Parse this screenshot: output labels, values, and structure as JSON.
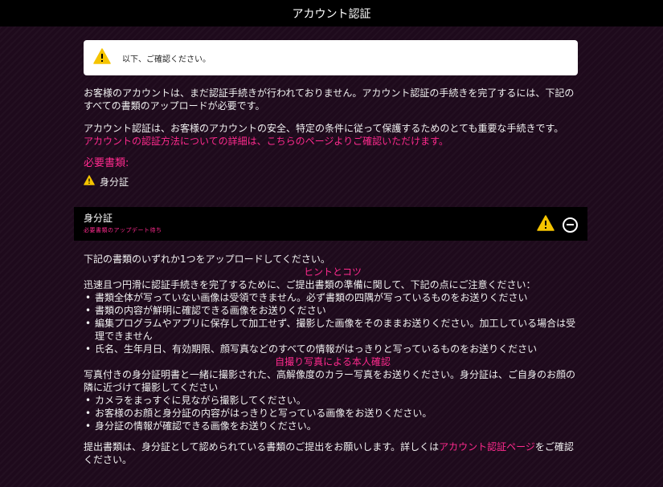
{
  "header": {
    "title": "アカウント認証"
  },
  "notice": {
    "text": "以下、ご確認ください。",
    "icon": "warning-icon"
  },
  "intro": {
    "p1": "お客様のアカウントは、まだ認証手続きが行われておりません。アカウント認証の手続きを完了するには、下記のすべての書類のアップロードが必要です。",
    "p2": "アカウント認証は、お客様のアカウントの安全、特定の条件に従って保護するためのとても重要な手続きです。",
    "link": "アカウントの認証方法についての詳細は、こちらのページよりご確認いただけます。"
  },
  "required_docs": {
    "title": "必要書類:",
    "items": [
      {
        "label": "身分証",
        "icon": "warning-icon"
      }
    ]
  },
  "panel": {
    "title": "身分証",
    "status": "必要書類のアップデート待ち"
  },
  "details": {
    "lead": "下記の書類のいずれか1つをアップロードしてください。",
    "tips_title": "ヒントとコツ",
    "tips_intro": "迅速且つ円滑に認証手続きを完了するために、ご提出書類の準備に関して、下記の点にご注意ください：",
    "tips": [
      "書類全体が写っていない画像は受領できません。必ず書類の四隅が写っているものをお送りください",
      "書類の内容が鮮明に確認できる画像をお送りください",
      "編集プログラムやアプリに保存して加工せず、撮影した画像をそのままお送りください。加工している場合は受理できません",
      "氏名、生年月日、有効期限、顔写真などのすべての情報がはっきりと写っているものをお送りください"
    ],
    "selfie_title": "自撮り写真による本人確認",
    "selfie_intro": "写真付きの身分証明書と一緒に撮影された、高解像度のカラー写真をお送りください。身分証は、ご自身のお顔の隣に近づけて撮影してください",
    "selfie_points": [
      "カメラをまっすぐに見ながら撮影してください。",
      "お客様のお顔と身分証の内容がはっきりと写っている画像をお送りください。",
      "身分証の情報が確認できる画像をお送りください。"
    ],
    "footer_before": "提出書類は、身分証として認められている書類のご提出をお願いします。詳しくは",
    "footer_link": "アカウント認証ページ",
    "footer_after": "をご確認ください。"
  },
  "colors": {
    "accent": "#ff2a8e",
    "warning": "#f5c400",
    "background": "#1e0a1c"
  }
}
